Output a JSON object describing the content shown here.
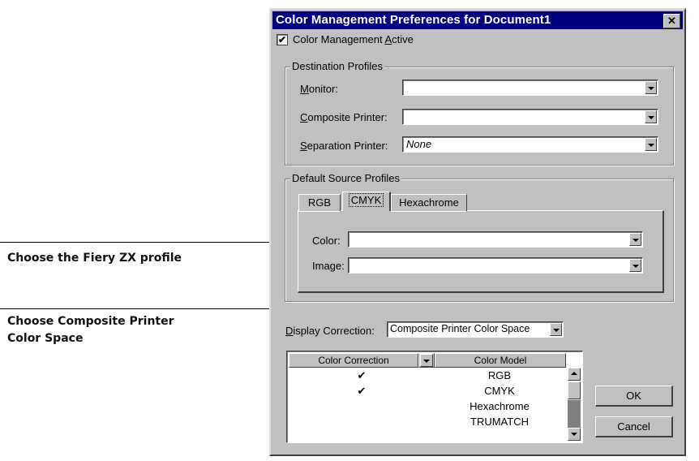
{
  "callouts": {
    "fiery_profile": "Choose the Fiery ZX profile",
    "composite_line1": "Choose Composite Printer",
    "composite_line2": "Color Space"
  },
  "dialog": {
    "title": "Color Management Preferences for Document1",
    "close_glyph": "✕",
    "cm_active": {
      "label_pre": "Color Management ",
      "label_u": "A",
      "label_post": "ctive",
      "checked": true,
      "check_glyph": "✔"
    },
    "destination": {
      "legend": "Destination Profiles",
      "monitor": {
        "u": "M",
        "rest": "onitor:",
        "value": ""
      },
      "composite": {
        "u": "C",
        "rest": "omposite Printer:",
        "value": ""
      },
      "separation": {
        "u": "S",
        "rest": "eparation Printer:",
        "value": "None"
      }
    },
    "source": {
      "legend": "Default Source Profiles",
      "tabs": [
        "RGB",
        "CMYK",
        "Hexachrome"
      ],
      "active_tab": "CMYK",
      "color_label": "Color:",
      "image_label": "Image:",
      "color_value": "",
      "image_value": ""
    },
    "display_correction": {
      "u": "D",
      "rest": "isplay Correction:",
      "value": "Composite Printer Color Space"
    },
    "list": {
      "col1": "Color Correction",
      "col2": "Color Model",
      "rows": [
        {
          "check": "✔",
          "model": "RGB"
        },
        {
          "check": "✔",
          "model": "CMYK"
        },
        {
          "check": "",
          "model": "Hexachrome"
        },
        {
          "check": "",
          "model": "TRUMATCH"
        }
      ]
    },
    "ok": "OK",
    "cancel": "Cancel"
  }
}
